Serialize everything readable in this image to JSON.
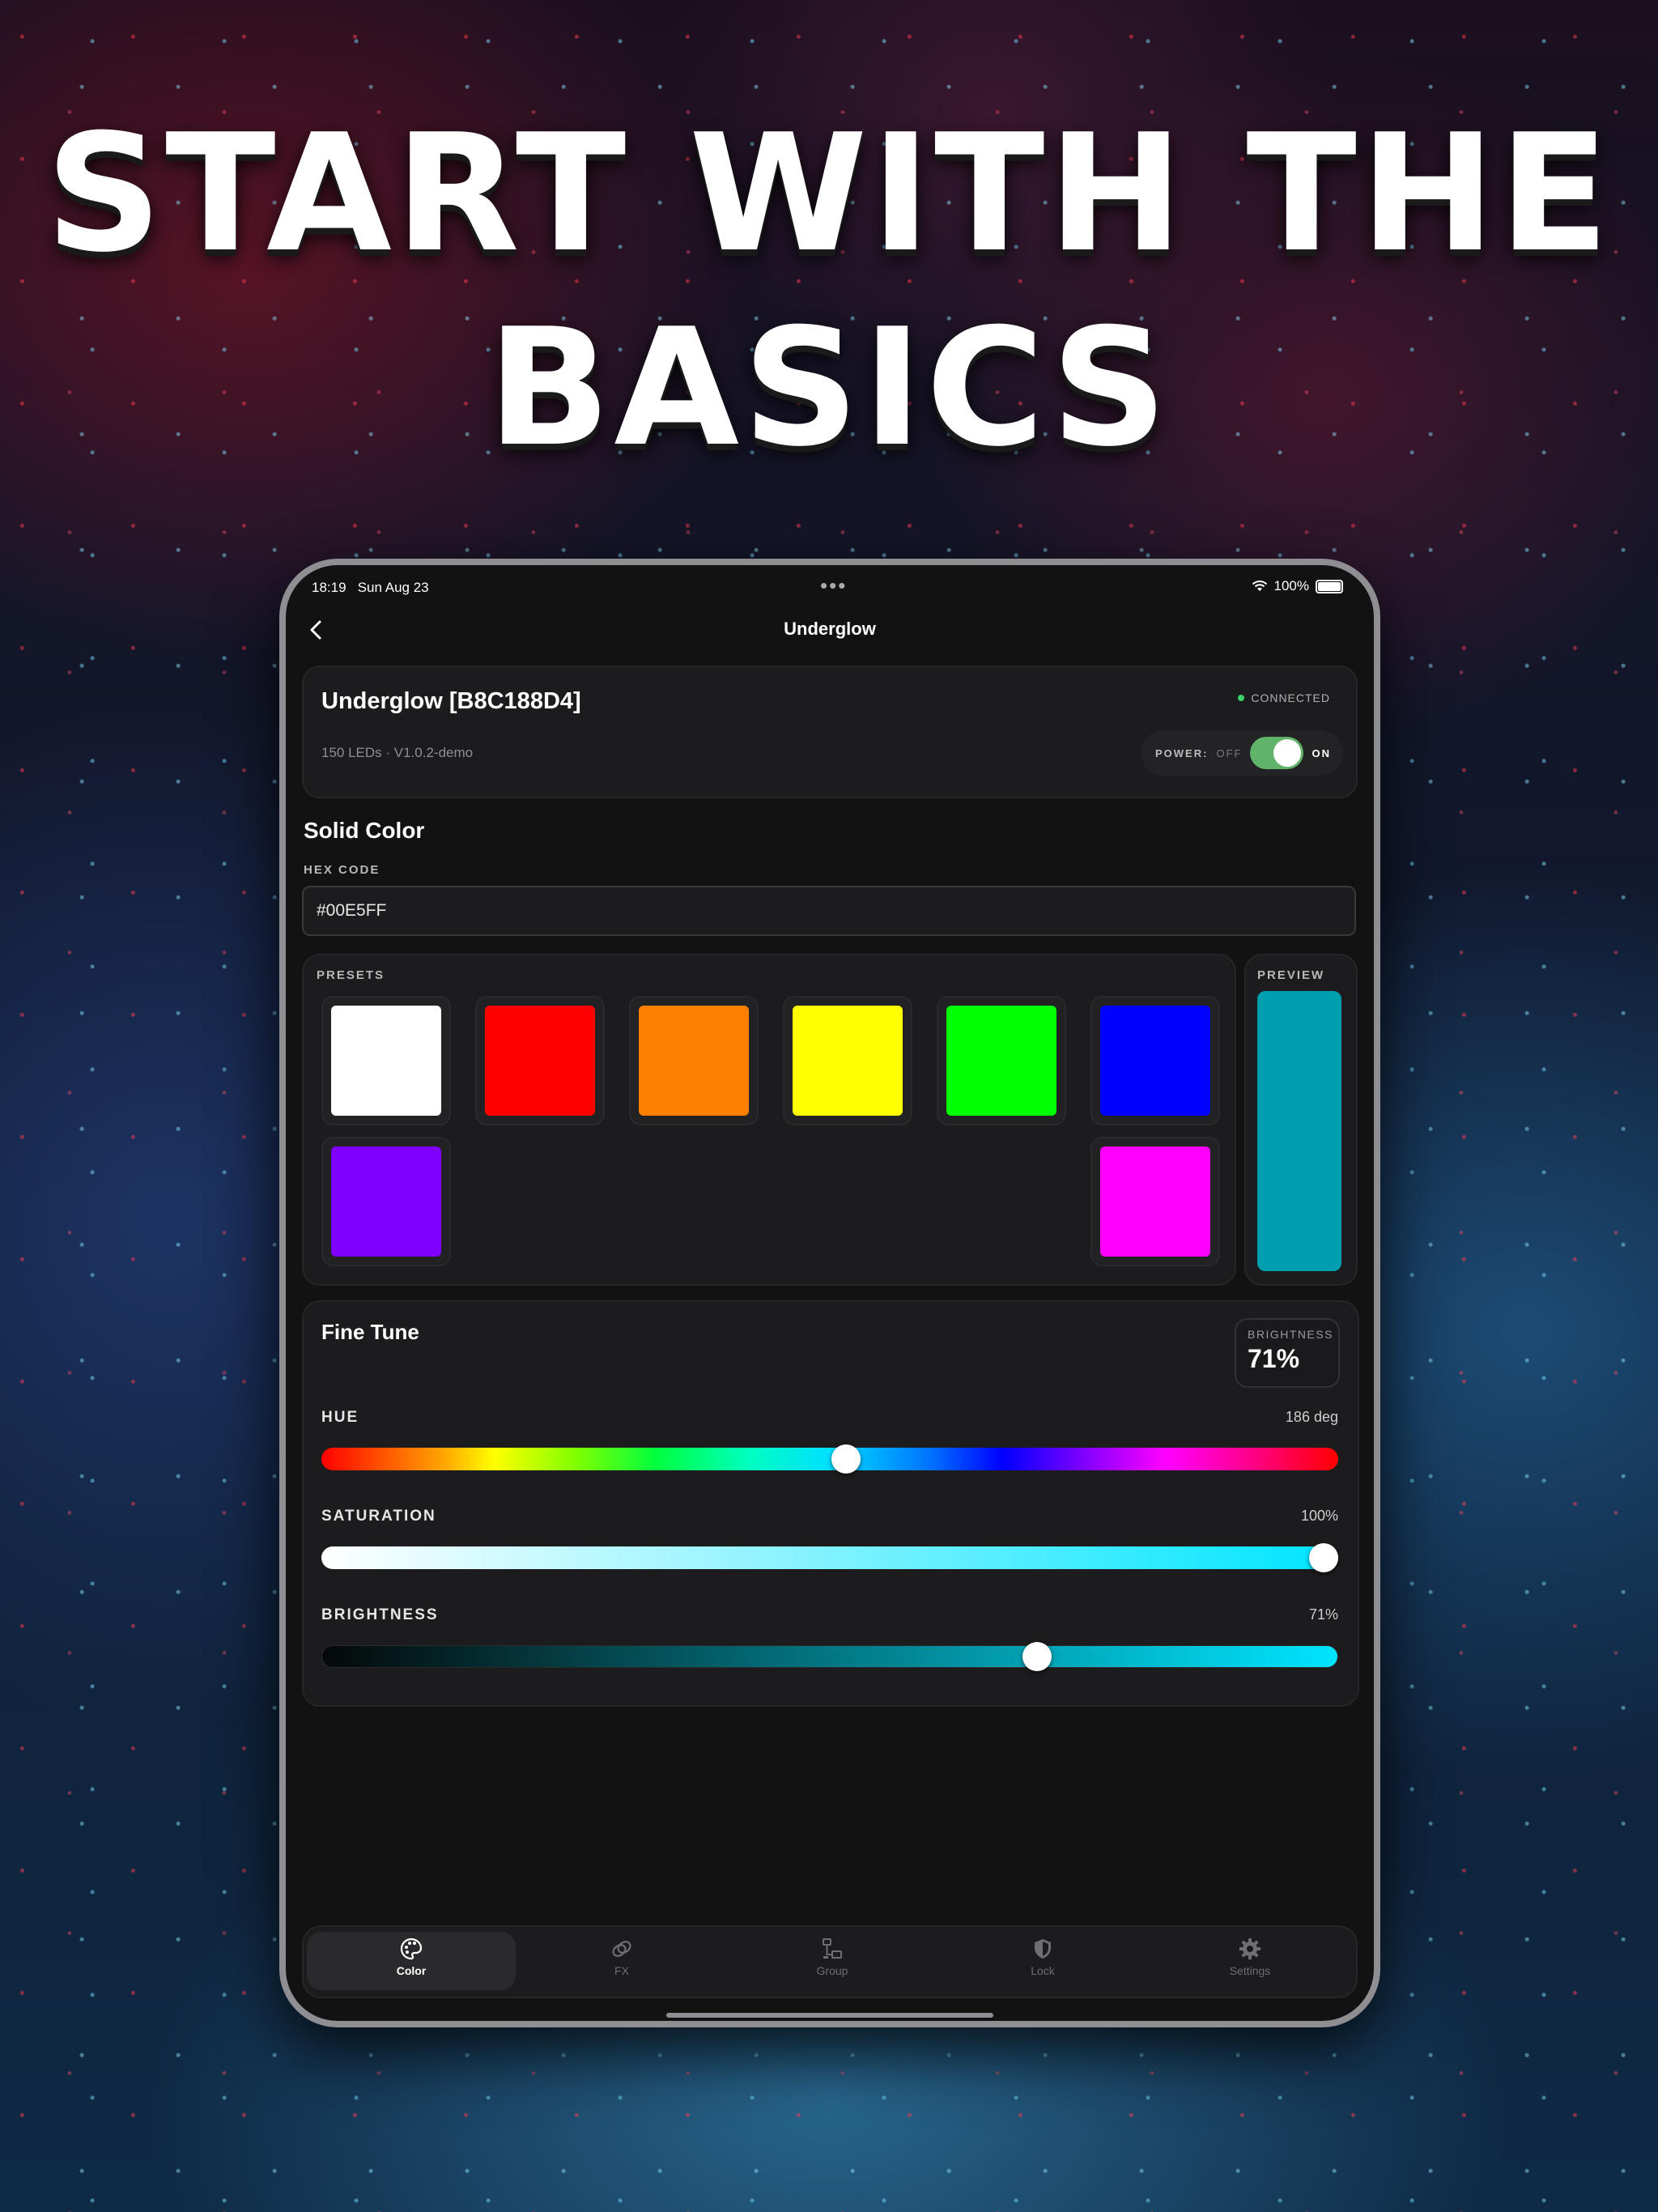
{
  "headline": {
    "line1": "START WITH THE",
    "line2": "BASICS"
  },
  "status_bar": {
    "time": "18:19",
    "date": "Sun Aug 23",
    "dots": "•••",
    "battery": "100%"
  },
  "nav": {
    "title": "Underglow"
  },
  "device": {
    "name": "Underglow [B8C188D4]",
    "meta": "150 LEDs · V1.0.2-demo",
    "status": "CONNECTED",
    "power_label": "POWER:",
    "power_off": "OFF",
    "power_on": "ON",
    "power_enabled": true
  },
  "solid_color": {
    "title": "Solid Color",
    "hex_label": "HEX CODE",
    "hex_value": "#00E5FF",
    "presets_label": "PRESETS",
    "preview_label": "PREVIEW",
    "preview_color": "#009fb0",
    "presets": [
      "#ffffff",
      "#ff0000",
      "#ff7f00",
      "#ffff00",
      "#00ff00",
      "#0000ff",
      "#7f00ff",
      "#ff00ff"
    ]
  },
  "fine_tune": {
    "title": "Fine Tune",
    "brightness_badge_label": "BRIGHTNESS",
    "brightness_badge_value": "71%",
    "hue": {
      "label": "HUE",
      "value_text": "186 deg",
      "value": 186,
      "max": 360
    },
    "saturation": {
      "label": "SATURATION",
      "value_text": "100%",
      "value": 100,
      "max": 100
    },
    "brightness": {
      "label": "BRIGHTNESS",
      "value_text": "71%",
      "value": 71,
      "max": 100
    }
  },
  "tabs": [
    {
      "label": "Color",
      "icon": "palette-icon",
      "active": true
    },
    {
      "label": "FX",
      "icon": "rings-icon",
      "active": false
    },
    {
      "label": "Group",
      "icon": "network-icon",
      "active": false
    },
    {
      "label": "Lock",
      "icon": "shield-icon",
      "active": false
    },
    {
      "label": "Settings",
      "icon": "gear-icon",
      "active": false
    }
  ]
}
